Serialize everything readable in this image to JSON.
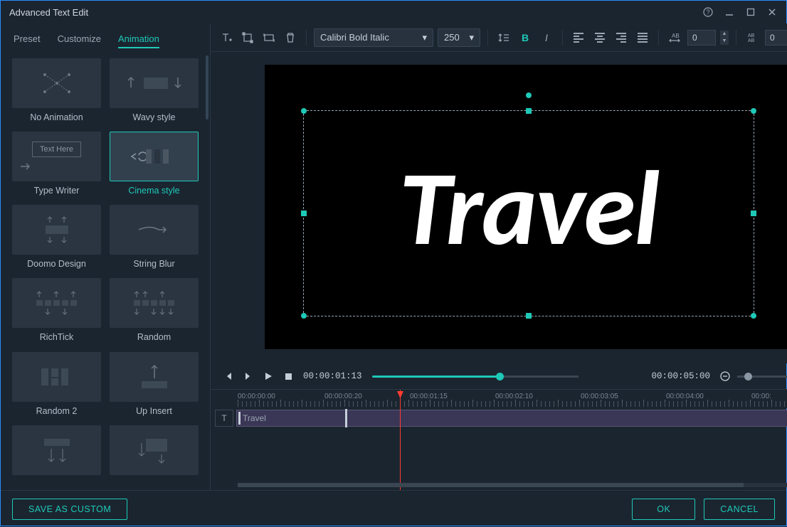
{
  "window": {
    "title": "Advanced Text Edit"
  },
  "tabs": {
    "preset": "Preset",
    "customize": "Customize",
    "animation": "Animation"
  },
  "animations": [
    {
      "id": "none",
      "label": "No Animation"
    },
    {
      "id": "wavy",
      "label": "Wavy style"
    },
    {
      "id": "typewriter",
      "label": "Type Writer",
      "thumb_text": "Text Here"
    },
    {
      "id": "cinema",
      "label": "Cinema style",
      "selected": true
    },
    {
      "id": "doomo",
      "label": "Doomo Design"
    },
    {
      "id": "stringblur",
      "label": "String Blur"
    },
    {
      "id": "richtick",
      "label": "RichTick"
    },
    {
      "id": "random",
      "label": "Random"
    },
    {
      "id": "random2",
      "label": "Random 2"
    },
    {
      "id": "upinsert",
      "label": "Up Insert"
    },
    {
      "id": "extra1",
      "label": ""
    },
    {
      "id": "extra2",
      "label": ""
    }
  ],
  "toolbar": {
    "font": "Calibri Bold Italic",
    "size": "250",
    "spacing": "0",
    "lineheight": "0"
  },
  "preview": {
    "text": "Travel"
  },
  "playbar": {
    "current": "00:00:01:13",
    "total": "00:00:05:00"
  },
  "ruler": [
    "00:00:00:00",
    "00:00:00:20",
    "00:00:01:15",
    "00:00:02:10",
    "00:00:03:05",
    "00:00:04:00",
    "00:00:"
  ],
  "clip": {
    "label": "Travel"
  },
  "footer": {
    "save_custom": "SAVE AS CUSTOM",
    "ok": "OK",
    "cancel": "CANCEL"
  }
}
